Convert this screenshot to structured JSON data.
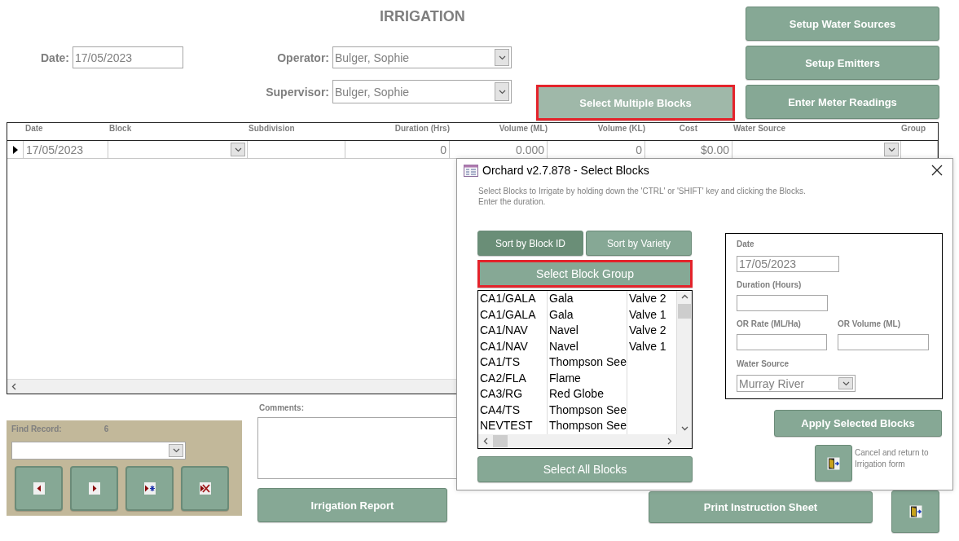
{
  "form": {
    "title": "IRRIGATION",
    "date": {
      "label": "Date:",
      "value": "17/05/2023"
    },
    "operator": {
      "label": "Operator:",
      "value": "Bulger, Sophie"
    },
    "supervisor": {
      "label": "Supervisor:",
      "value": "Bulger, Sophie"
    },
    "select_multiple_button": {
      "label": "Select Multiple Blocks",
      "highlighted": true
    },
    "setup_buttons": [
      {
        "label": "Setup Water Sources",
        "highlighted": false
      },
      {
        "label": "Setup Emitters",
        "highlighted": false
      },
      {
        "label": "Enter Meter Readings",
        "highlighted": false
      }
    ]
  },
  "datasheet": {
    "columns": [
      {
        "label": "Date",
        "kind": "text"
      },
      {
        "label": "Block",
        "kind": "combo"
      },
      {
        "label": "Subdivision",
        "kind": "text"
      },
      {
        "label": "Duration (Hrs)",
        "kind": "number"
      },
      {
        "label": "Volume (ML)",
        "kind": "number"
      },
      {
        "label": "Volume (KL)",
        "kind": "number"
      },
      {
        "label": "Cost",
        "kind": "number"
      },
      {
        "label": "Water Source",
        "kind": "combo"
      },
      {
        "label": "Group",
        "kind": "text"
      }
    ],
    "rows": [
      {
        "current": true,
        "cells": [
          "17/05/2023",
          null,
          null,
          "0",
          "0.000",
          "0",
          "$0.00",
          null,
          null
        ]
      }
    ]
  },
  "find_record": {
    "label": "Find Record:",
    "count": "6",
    "nav_buttons": [
      {
        "kind": "previous"
      },
      {
        "kind": "next"
      },
      {
        "kind": "new"
      },
      {
        "kind": "delete"
      }
    ]
  },
  "comments": {
    "label": "Comments:"
  },
  "bottom_buttons": [
    {
      "label": "Irrigation Report",
      "highlighted": false
    },
    {
      "label": "Print Instruction Sheet",
      "highlighted": false
    }
  ],
  "dialog": {
    "title": "Orchard v2.7.878 - Select Blocks",
    "instructions": [
      "Select Blocks to Irrigate by holding down the 'CTRL' or 'SHIFT' key and clicking the Blocks.",
      "Enter the duration."
    ],
    "sort_tabs": [
      {
        "label": "Sort by Block ID",
        "selected": true
      },
      {
        "label": "Sort by Variety",
        "selected": false
      }
    ],
    "group_button": {
      "label": "Select Block Group",
      "highlighted": true
    },
    "blocks": [
      {
        "block": "CA1/GALA",
        "variety": "Gala",
        "valve": "Valve 2"
      },
      {
        "block": "CA1/GALA",
        "variety": "Gala",
        "valve": "Valve 1"
      },
      {
        "block": "CA1/NAV",
        "variety": "Navel",
        "valve": "Valve 2"
      },
      {
        "block": "CA1/NAV",
        "variety": "Navel",
        "valve": "Valve 1"
      },
      {
        "block": "CA1/TS",
        "variety": "Thompson See"
      },
      {
        "block": "CA2/FLA",
        "variety": "Flame"
      },
      {
        "block": "CA3/RG",
        "variety": "Red Globe"
      },
      {
        "block": "CA4/TS",
        "variety": "Thompson See"
      },
      {
        "block": "NEVTEST",
        "variety": "Thompson See"
      }
    ],
    "select_all_button": {
      "label": "Select All Blocks",
      "highlighted": false
    },
    "date": {
      "label": "Date",
      "value": "17/05/2023"
    },
    "duration": {
      "label": "Duration (Hours)"
    },
    "rate": {
      "label": "OR Rate (ML/Ha)"
    },
    "volume": {
      "label": "OR Volume (ML)"
    },
    "water_source": {
      "label": "Water Source",
      "value": "Murray River"
    },
    "apply_button": {
      "label": "Apply Selected Blocks",
      "highlighted": false
    },
    "cancel": {
      "text": "Cancel and return to Irrigation form"
    }
  }
}
